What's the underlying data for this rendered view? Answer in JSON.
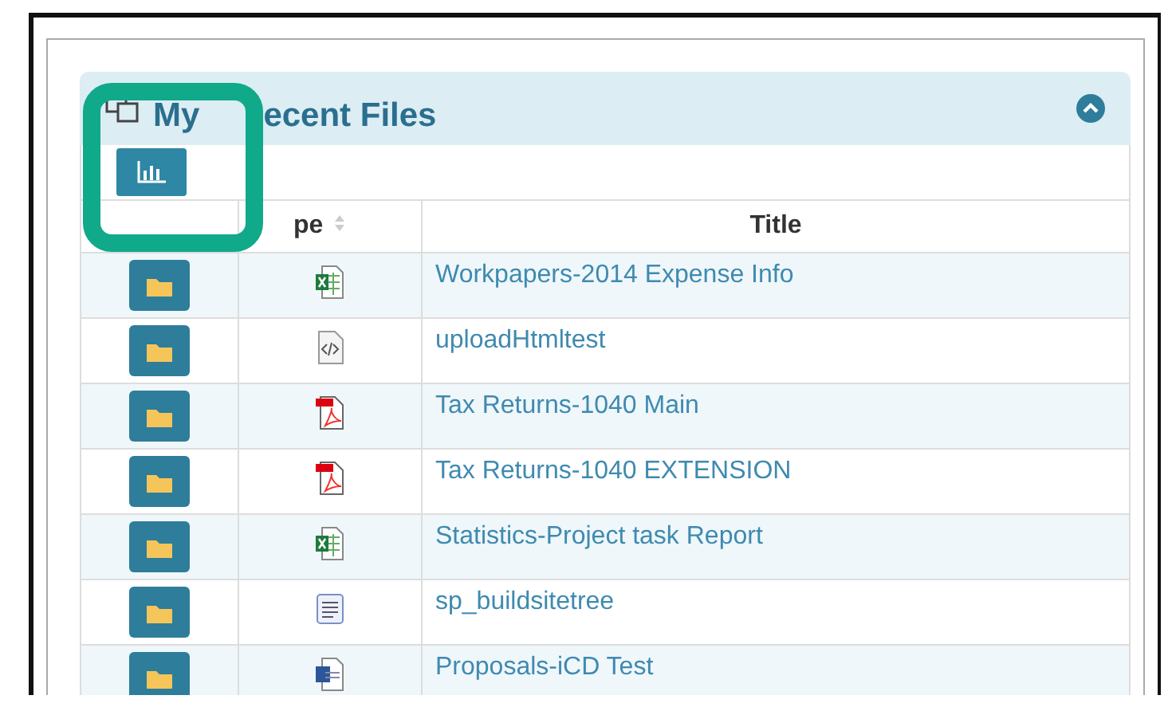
{
  "panel": {
    "title_parts": [
      "My",
      "ecent Files"
    ],
    "expanded": true
  },
  "table": {
    "columns": [
      "pe",
      "Title"
    ],
    "rows": [
      {
        "kind": "excel",
        "title": "Workpapers-2014 Expense Info"
      },
      {
        "kind": "code",
        "title": "uploadHtmltest"
      },
      {
        "kind": "pdf",
        "title": "Tax Returns-1040 Main"
      },
      {
        "kind": "pdf",
        "title": "Tax Returns-1040 EXTENSION"
      },
      {
        "kind": "excel",
        "title": "Statistics-Project task Report"
      },
      {
        "kind": "text",
        "title": "sp_buildsitetree"
      },
      {
        "kind": "word",
        "title": "Proposals-iCD Test"
      }
    ]
  }
}
